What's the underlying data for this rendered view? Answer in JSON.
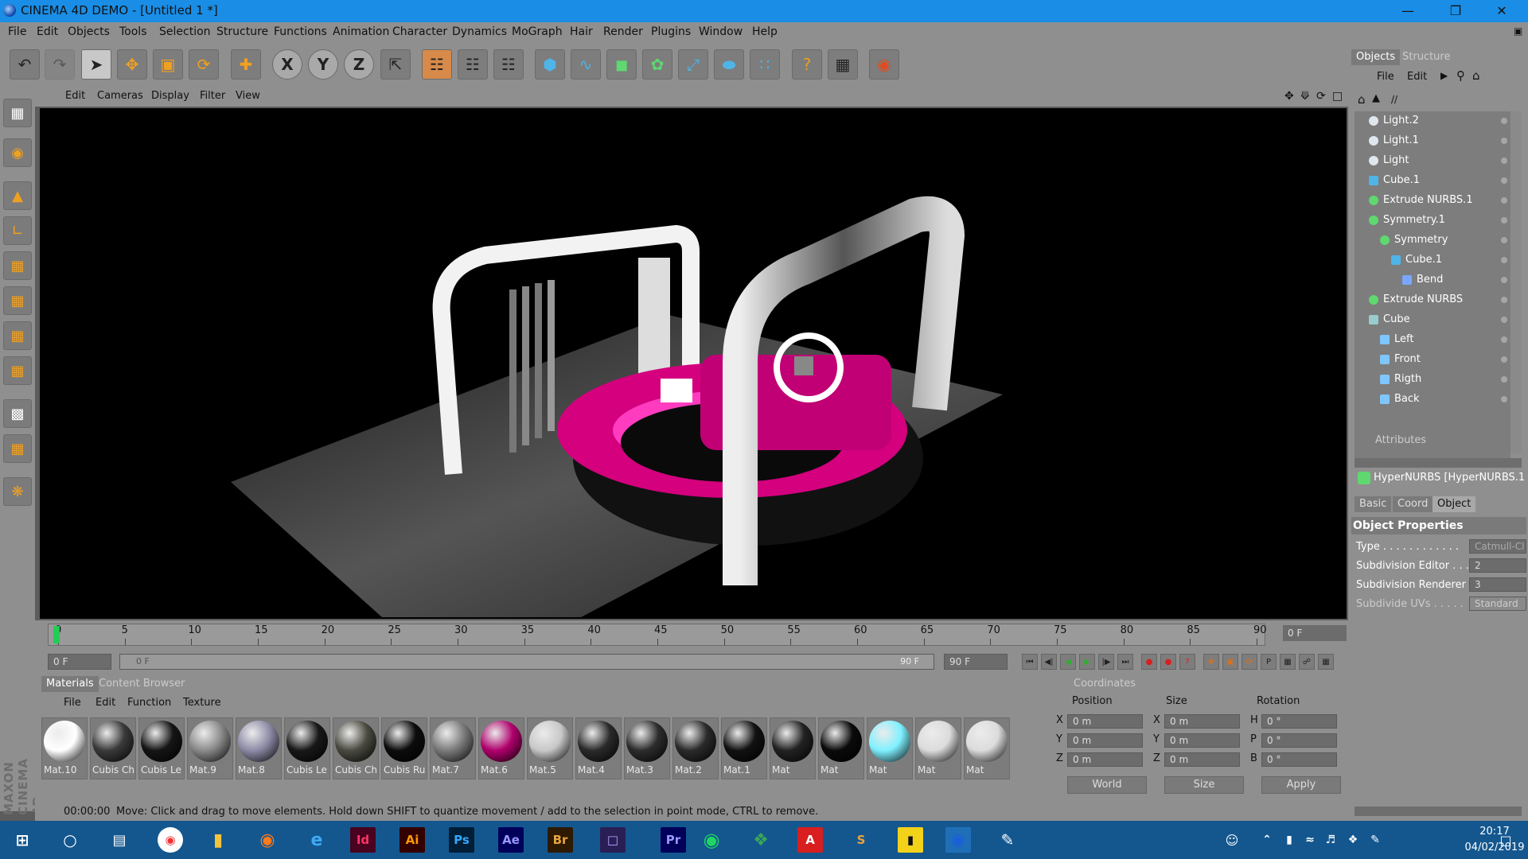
{
  "window": {
    "title": "CINEMA 4D DEMO - [Untitled 1 *]"
  },
  "menubar": [
    "File",
    "Edit",
    "Objects",
    "Tools",
    "Selection",
    "Structure",
    "Functions",
    "Animation",
    "Character",
    "Dynamics",
    "MoGraph",
    "Hair",
    "Render",
    "Plugins",
    "Window",
    "Help"
  ],
  "viewport_menu": [
    "Edit",
    "Cameras",
    "Display",
    "Filter",
    "View"
  ],
  "timeline": {
    "ticks": [
      "0",
      "5",
      "10",
      "15",
      "20",
      "25",
      "30",
      "35",
      "40",
      "45",
      "50",
      "55",
      "60",
      "65",
      "70",
      "75",
      "80",
      "85",
      "90"
    ],
    "current_frame": "0 F",
    "start_field": "0 F",
    "range_start": "0 F",
    "range_end": "90 F",
    "end_field": "90 F"
  },
  "materials": {
    "tabs": [
      "Materials",
      "Content Browser"
    ],
    "menu": [
      "File",
      "Edit",
      "Function",
      "Texture"
    ],
    "items": [
      {
        "label": "Mat.10",
        "color": "#ffffff"
      },
      {
        "label": "Cubis Ch",
        "color": "#3a3a3a"
      },
      {
        "label": "Cubis Le",
        "color": "#151515"
      },
      {
        "label": "Mat.9",
        "color": "#8a8a8a"
      },
      {
        "label": "Mat.8",
        "color": "#8c8aa6"
      },
      {
        "label": "Cubis Le",
        "color": "#181818"
      },
      {
        "label": "Cubis Ch",
        "color": "#4a4a40"
      },
      {
        "label": "Cubis Ru",
        "color": "#0c0c0c"
      },
      {
        "label": "Mat.7",
        "color": "#7a7a7a"
      },
      {
        "label": "Mat.6",
        "color": "#b0006c"
      },
      {
        "label": "Mat.5",
        "color": "#c8c8c8"
      },
      {
        "label": "Mat.4",
        "color": "#2a2a2a"
      },
      {
        "label": "Mat.3",
        "color": "#2c2c2c"
      },
      {
        "label": "Mat.2",
        "color": "#2a2a2a"
      },
      {
        "label": "Mat.1",
        "color": "#111111"
      },
      {
        "label": "Mat",
        "color": "#222222"
      },
      {
        "label": "Mat",
        "color": "#0a0a0a"
      },
      {
        "label": "Mat",
        "color": "#7ff0ff"
      },
      {
        "label": "Mat",
        "color": "#dcdcdc"
      },
      {
        "label": "Mat",
        "color": "#dcdcdc"
      }
    ]
  },
  "coordinates": {
    "title": "Coordinates",
    "headers": [
      "Position",
      "Size",
      "Rotation"
    ],
    "pos": [
      {
        "axis": "X",
        "value": "0 m"
      },
      {
        "axis": "Y",
        "value": "0 m"
      },
      {
        "axis": "Z",
        "value": "0 m"
      }
    ],
    "size": [
      {
        "axis": "X",
        "value": "0 m"
      },
      {
        "axis": "Y",
        "value": "0 m"
      },
      {
        "axis": "Z",
        "value": "0 m"
      }
    ],
    "rot": [
      {
        "axis": "H",
        "value": "0 °"
      },
      {
        "axis": "P",
        "value": "0 °"
      },
      {
        "axis": "B",
        "value": "0 °"
      }
    ],
    "mode1": "World",
    "mode2": "Size",
    "apply": "Apply"
  },
  "status": {
    "time": "00:00:00",
    "message": "Move: Click and drag to move elements. Hold down SHIFT to quantize movement / add to the selection in point mode, CTRL to remove."
  },
  "objects_panel": {
    "tabs": [
      "Objects",
      "Structure"
    ],
    "menu": [
      "File",
      "Edit"
    ],
    "path": "//",
    "tree": [
      {
        "label": "Light.2",
        "indent": 0,
        "icon": "light"
      },
      {
        "label": "Light.1",
        "indent": 0,
        "icon": "light"
      },
      {
        "label": "Light",
        "indent": 0,
        "icon": "light"
      },
      {
        "label": "Cube.1",
        "indent": 0,
        "icon": "cube"
      },
      {
        "label": "Extrude NURBS.1",
        "indent": 0,
        "icon": "nurbs"
      },
      {
        "label": "Symmetry.1",
        "indent": 0,
        "icon": "nurbs"
      },
      {
        "label": "Symmetry",
        "indent": 1,
        "icon": "nurbs"
      },
      {
        "label": "Cube.1",
        "indent": 2,
        "icon": "cube"
      },
      {
        "label": "Bend",
        "indent": 3,
        "icon": "deform"
      },
      {
        "label": "Extrude NURBS",
        "indent": 0,
        "icon": "nurbs"
      },
      {
        "label": "Cube",
        "indent": 0,
        "icon": "null"
      },
      {
        "label": "Left",
        "indent": 1,
        "icon": "cam"
      },
      {
        "label": "Front",
        "indent": 1,
        "icon": "cam"
      },
      {
        "label": "Rigth",
        "indent": 1,
        "icon": "cam"
      },
      {
        "label": "Back",
        "indent": 1,
        "icon": "cam"
      }
    ]
  },
  "attributes": {
    "title": "Attributes",
    "object": "HyperNURBS [HyperNURBS.1",
    "tabs": [
      "Basic",
      "Coord",
      "Object"
    ],
    "section": "Object Properties",
    "props": [
      {
        "label": "Type . . . . . . . . . . . .",
        "value": "Catmull-Cl"
      },
      {
        "label": "Subdivision Editor . . .",
        "value": "2"
      },
      {
        "label": "Subdivision Renderer",
        "value": "3"
      },
      {
        "label": "Subdivide UVs . . . . .",
        "value": "Standard"
      }
    ]
  },
  "taskbar": {
    "apps": [
      {
        "text": "Id",
        "bg": "#49021f",
        "fg": "#ff3366"
      },
      {
        "text": "Ai",
        "bg": "#330000",
        "fg": "#ff9a00"
      },
      {
        "text": "Ps",
        "bg": "#001e36",
        "fg": "#31a8ff"
      },
      {
        "text": "Ae",
        "bg": "#00005b",
        "fg": "#9999ff"
      },
      {
        "text": "Br",
        "bg": "#2d1a00",
        "fg": "#e8a33d"
      },
      {
        "text": "Pr",
        "bg": "#00005b",
        "fg": "#9999ff"
      }
    ],
    "time": "20:17",
    "date": "04/02/2019"
  },
  "colors": {
    "accent": "#1a8ee6",
    "panel": "#8f8f8f",
    "magenta": "#e0008c"
  }
}
